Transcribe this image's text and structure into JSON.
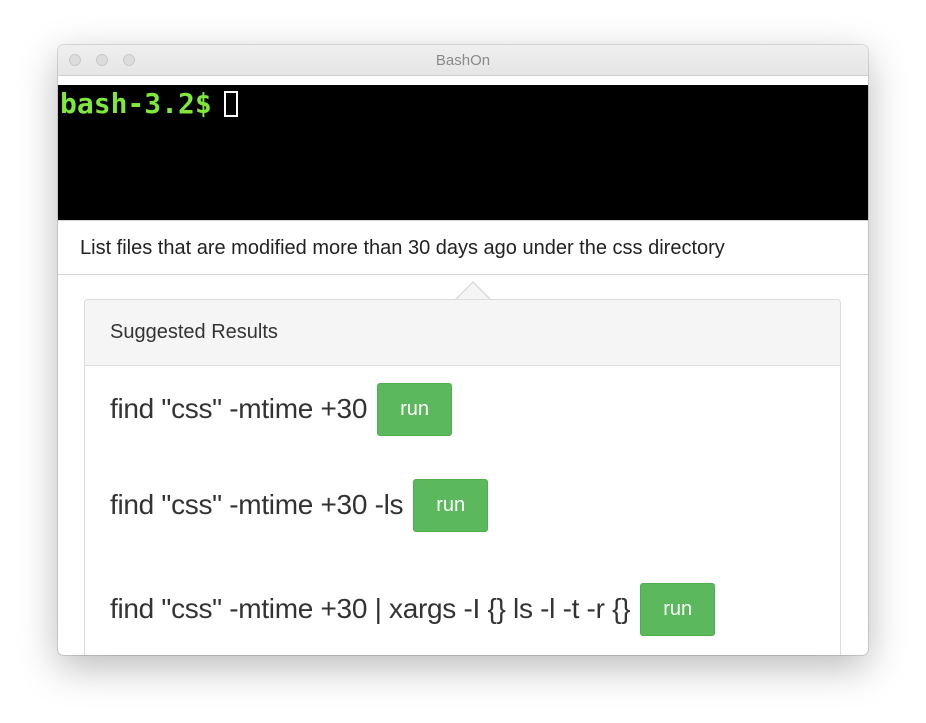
{
  "window": {
    "title": "BashOn"
  },
  "terminal": {
    "prompt": "bash-3.2$"
  },
  "query": {
    "text": "List files that are modified more than 30 days ago under the css directory"
  },
  "suggestions": {
    "header": "Suggested Results",
    "run_label": "run",
    "results": [
      {
        "command": "find \"css\" -mtime +30"
      },
      {
        "command": "find \"css\" -mtime +30 -ls"
      },
      {
        "command": "find \"css\" -mtime +30 | xargs -I {} ls -l -t -r {}"
      }
    ]
  },
  "colors": {
    "prompt": "#7ee83b",
    "run_button": "#5cb85c",
    "terminal_bg": "#000000"
  }
}
